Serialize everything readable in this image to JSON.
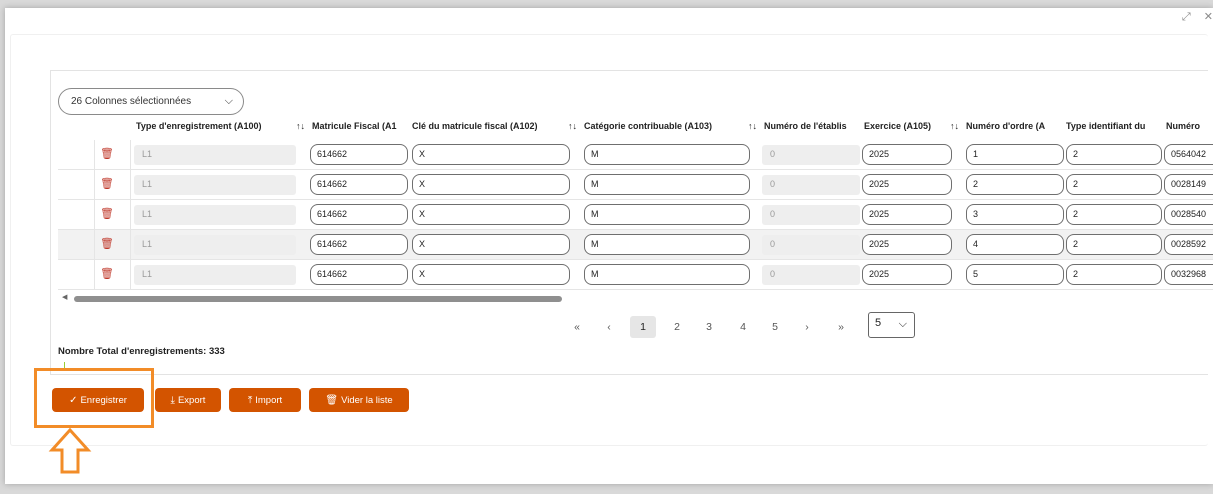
{
  "window": {
    "controls": [
      "⤢",
      "✕"
    ]
  },
  "column_selector": {
    "label": "26 Colonnes sélectionnées",
    "chevron_icon": "chevron-down-icon"
  },
  "headers": [
    "Type d'enregistrement (A100)",
    "Matricule Fiscal (A1",
    "Clé du matricule fiscal (A102)",
    "Catégorie contribuable (A103)",
    "Numéro de l'établis",
    "Exercice (A105)",
    "Numéro d'ordre (A",
    "Type identifiant du",
    "Numéro"
  ],
  "rows": [
    {
      "type": "L1",
      "matricule": "614662",
      "cle": "X",
      "categorie": "M",
      "etab": "0",
      "exercice": "2025",
      "ordre": "1",
      "type_id": "2",
      "numero": "0564042"
    },
    {
      "type": "L1",
      "matricule": "614662",
      "cle": "X",
      "categorie": "M",
      "etab": "0",
      "exercice": "2025",
      "ordre": "2",
      "type_id": "2",
      "numero": "0028149"
    },
    {
      "type": "L1",
      "matricule": "614662",
      "cle": "X",
      "categorie": "M",
      "etab": "0",
      "exercice": "2025",
      "ordre": "3",
      "type_id": "2",
      "numero": "0028540"
    },
    {
      "type": "L1",
      "matricule": "614662",
      "cle": "X",
      "categorie": "M",
      "etab": "0",
      "exercice": "2025",
      "ordre": "4",
      "type_id": "2",
      "numero": "0028592"
    },
    {
      "type": "L1",
      "matricule": "614662",
      "cle": "X",
      "categorie": "M",
      "etab": "0",
      "exercice": "2025",
      "ordre": "5",
      "type_id": "2",
      "numero": "0032968"
    }
  ],
  "pagination": {
    "first": "«",
    "prev": "‹",
    "pages": [
      "1",
      "2",
      "3",
      "4",
      "5"
    ],
    "next": "›",
    "last": "»",
    "page_size": "5",
    "active_page": "1"
  },
  "total_label": "Nombre Total d'enregistrements: 333",
  "buttons": {
    "save": "Enregistrer",
    "export": "Export",
    "import": "Import",
    "clear": "Vider la liste"
  },
  "colors": {
    "accent": "#d35400",
    "highlight": "#f28c28",
    "delete": "#c0392b"
  }
}
